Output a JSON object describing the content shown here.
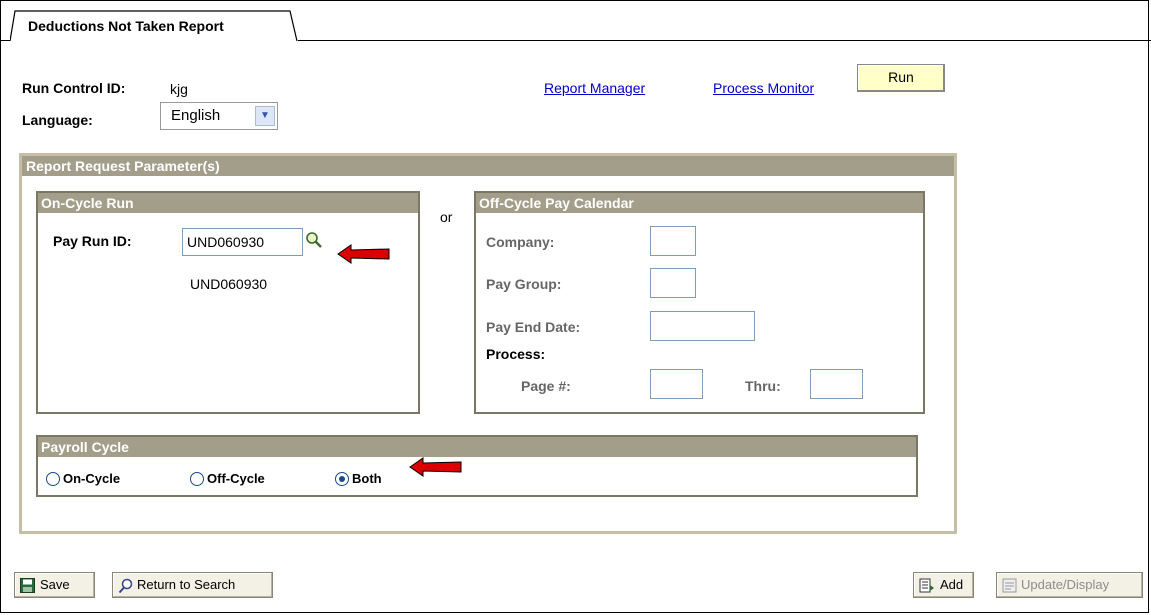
{
  "tab": {
    "title": "Deductions Not Taken Report"
  },
  "header": {
    "run_control_label": "Run Control ID:",
    "run_control_value": "kjg",
    "language_label": "Language:",
    "language_value": "English",
    "report_manager_link": "Report Manager",
    "process_monitor_link": "Process Monitor",
    "run_button": "Run"
  },
  "report_params": {
    "title": "Report Request Parameter(s)",
    "or_text": "or",
    "on_cycle": {
      "title": "On-Cycle Run",
      "pay_run_id_label": "Pay Run ID:",
      "pay_run_id_value": "UND060930",
      "pay_run_id_description": "UND060930"
    },
    "off_cycle": {
      "title": "Off-Cycle Pay Calendar",
      "company_label": "Company:",
      "pay_group_label": "Pay Group:",
      "pay_end_date_label": "Pay End Date:",
      "process_label": "Process:",
      "page_label": "Page #:",
      "thru_label": "Thru:"
    },
    "payroll_cycle": {
      "title": "Payroll Cycle",
      "options": [
        "On-Cycle",
        "Off-Cycle",
        "Both"
      ],
      "selected": "Both"
    }
  },
  "footer": {
    "save": "Save",
    "return_to_search": "Return to Search",
    "add": "Add",
    "update_display": "Update/Display"
  },
  "colors": {
    "section_header": "#a39e8a",
    "panel_border": "#c8bea6",
    "annotation_arrow": "#dd0000",
    "run_button_bg": "#ffffc8",
    "link": "#0000cc"
  }
}
